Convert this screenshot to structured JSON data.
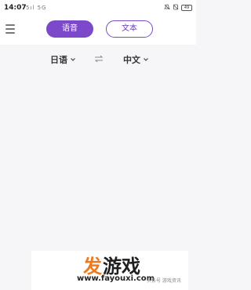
{
  "status_bar": {
    "time": "14:07",
    "signal": "5ıl 5G",
    "battery": "49"
  },
  "mode_tabs": [
    {
      "label": "语音",
      "active": true
    },
    {
      "label": "文本",
      "active": false
    }
  ],
  "languages": {
    "source": "日语",
    "target": "中文"
  },
  "colors": {
    "accent": "#7b49c9",
    "page_bg": "#f6f6f9"
  },
  "icons": {
    "menu": "menu-icon",
    "swap": "swap-icon",
    "chevron": "chevron-down-icon"
  },
  "watermark": {
    "logo_part1": "发",
    "logo_part2": "游戏",
    "url": "www.fayouxi.com",
    "credit": "头条号 游戏资讯"
  }
}
